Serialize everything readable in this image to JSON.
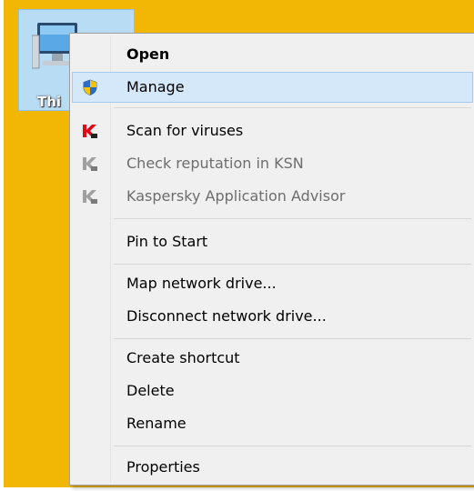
{
  "desktop": {
    "icon_label": "Thi",
    "icon": "computer-monitor-icon"
  },
  "colors": {
    "desktop_background": "#f2b705",
    "menu_background": "#f0f0f0",
    "highlight": "#d5e8f9",
    "kaspersky_red": "#e30613"
  },
  "context_menu": {
    "items": [
      {
        "label": "Open",
        "bold": true
      },
      {
        "label": "Manage",
        "icon": "uac-shield-icon",
        "highlighted": true
      },
      {
        "label": "Scan for viruses",
        "icon": "kaspersky-icon"
      },
      {
        "label": "Check reputation in KSN",
        "icon": "kaspersky-icon",
        "disabled": true
      },
      {
        "label": "Kaspersky Application Advisor",
        "icon": "kaspersky-icon",
        "disabled": true
      },
      {
        "label": "Pin to Start"
      },
      {
        "label": "Map network drive..."
      },
      {
        "label": "Disconnect network drive..."
      },
      {
        "label": "Create shortcut"
      },
      {
        "label": "Delete"
      },
      {
        "label": "Rename"
      },
      {
        "label": "Properties"
      }
    ]
  }
}
